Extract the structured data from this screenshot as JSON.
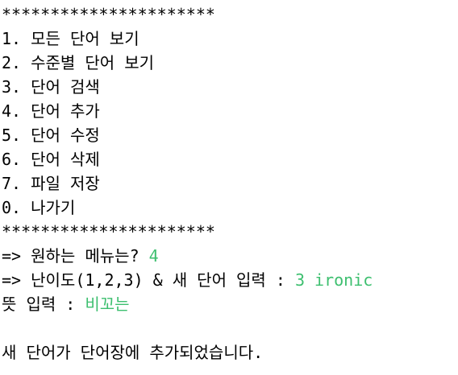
{
  "terminal": {
    "separator": "**********************",
    "menu": [
      "1. 모든 단어 보기",
      "2. 수준별 단어 보기",
      "3. 단어 검색",
      "4. 단어 추가",
      "5. 단어 수정",
      "6. 단어 삭제",
      "7. 파일 저장",
      "0. 나가기"
    ],
    "prompt_menu": "=> 원하는 메뉴는? ",
    "input_menu": "4",
    "prompt_level_word": "=> 난이도(1,2,3) & 새 단어 입력 : ",
    "input_level_word": "3 ironic",
    "prompt_meaning": "뜻 입력 : ",
    "input_meaning": "비꼬는",
    "result": "새 단어가 단어장에 추가되었습니다.",
    "colors": {
      "background": "#ffffff",
      "text": "#000000",
      "user_input": "#3dbf6f"
    }
  }
}
